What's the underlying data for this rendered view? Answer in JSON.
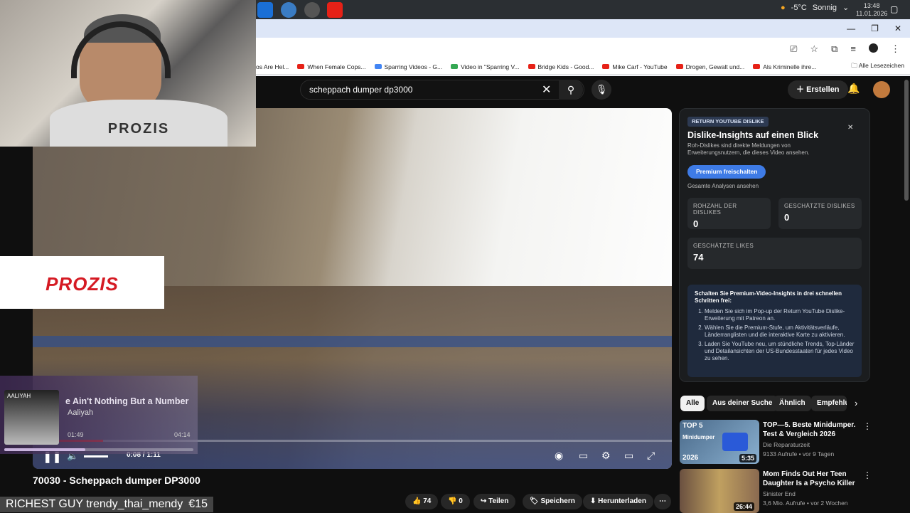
{
  "taskbar": {
    "weather": {
      "temp": "-5°C",
      "condition": "Sonnig"
    },
    "clock": {
      "time": "13:48",
      "date": "11.01.2026"
    }
  },
  "bookmarks": {
    "items": [
      "os Are Hel...",
      "When Female Cops...",
      "Sparring Videos - G...",
      "Video in \"Sparring V...",
      "Bridge Kids - Good...",
      "Mike Carf - YouTube",
      "Drogen, Gewalt und...",
      "Als Kriminelle ihre..."
    ],
    "more": "»",
    "all_label": "Alle Lesezeichen"
  },
  "header": {
    "search_query": "scheppach dumper dp3000",
    "create_label": "Erstellen"
  },
  "webcam": {
    "shirt_text": "PROZIS",
    "sponsor": "PROZIS"
  },
  "music": {
    "title": "e Ain't Nothing But a Number",
    "artist": "Aaliyah",
    "elapsed": "01:49",
    "total": "04:14",
    "cover_text": "AALIYAH",
    "progress": 0.43
  },
  "player": {
    "time": "0:08 / 1:11",
    "progress": 0.11
  },
  "video": {
    "title": "70030 - Scheppach dumper DP3000",
    "likes": "74",
    "dislikes": "0",
    "share": "Teilen",
    "save": "Speichern",
    "download": "Herunterladen"
  },
  "donation": {
    "text": "RICHEST GUY trendy_thai_mendy",
    "amount": "€15"
  },
  "dislike_panel": {
    "badge": "RETURN YOUTUBE DISLIKE",
    "heading": "Dislike-Insights auf einen Blick",
    "subtitle": "Roh-Dislikes sind direkte Meldungen von Erweiterungsnutzern, die dieses Video ansehen.",
    "button": "Premium freischalten",
    "link": "Gesamte Analysen ansehen",
    "raw_label": "ROHZAHL DER DISLIKES",
    "raw_value": "0",
    "est_dislikes_label": "GESCHÄTZTE DISLIKES",
    "est_dislikes_value": "0",
    "est_likes_label": "GESCHÄTZTE LIKES",
    "est_likes_value": "74",
    "box_title": "Schalten Sie Premium-Video-Insights in drei schnellen Schritten frei:",
    "steps": [
      "Melden Sie sich im Pop-up der Return YouTube Dislike-Erweiterung mit Patreon an.",
      "Wählen Sie die Premium-Stufe, um Aktivitätsverläufe, Länderranglisten und die interaktive Karte zu aktivieren.",
      "Laden Sie YouTube neu, um stündliche Trends, Top-Länder und Detailansichten der US-Bundesstaaten für jedes Video zu sehen."
    ]
  },
  "chips": [
    "Alle",
    "Aus deiner Suche",
    "Ähnlich",
    "Empfehlu"
  ],
  "recommendations": [
    {
      "title": "TOP—5. Beste Minidumper. Test & Vergleich 2026",
      "channel": "Die Reparaturzeit",
      "meta": "9133 Aufrufe • vor 9 Tagen",
      "duration": "5:35",
      "thumb_top": "TOP 5",
      "thumb_sub": "Minidumper",
      "thumb_year": "2026"
    },
    {
      "title": "Mom Finds Out Her Teen Daughter Is a Psycho Killer",
      "channel": "Sinister End",
      "meta": "3,6 Mio. Aufrufe • vor 2 Wochen",
      "duration": "26:44"
    }
  ],
  "colors": {
    "accent_red": "#ff0000",
    "panel_button": "#3e7be6",
    "prozis_red": "#d51a23"
  }
}
